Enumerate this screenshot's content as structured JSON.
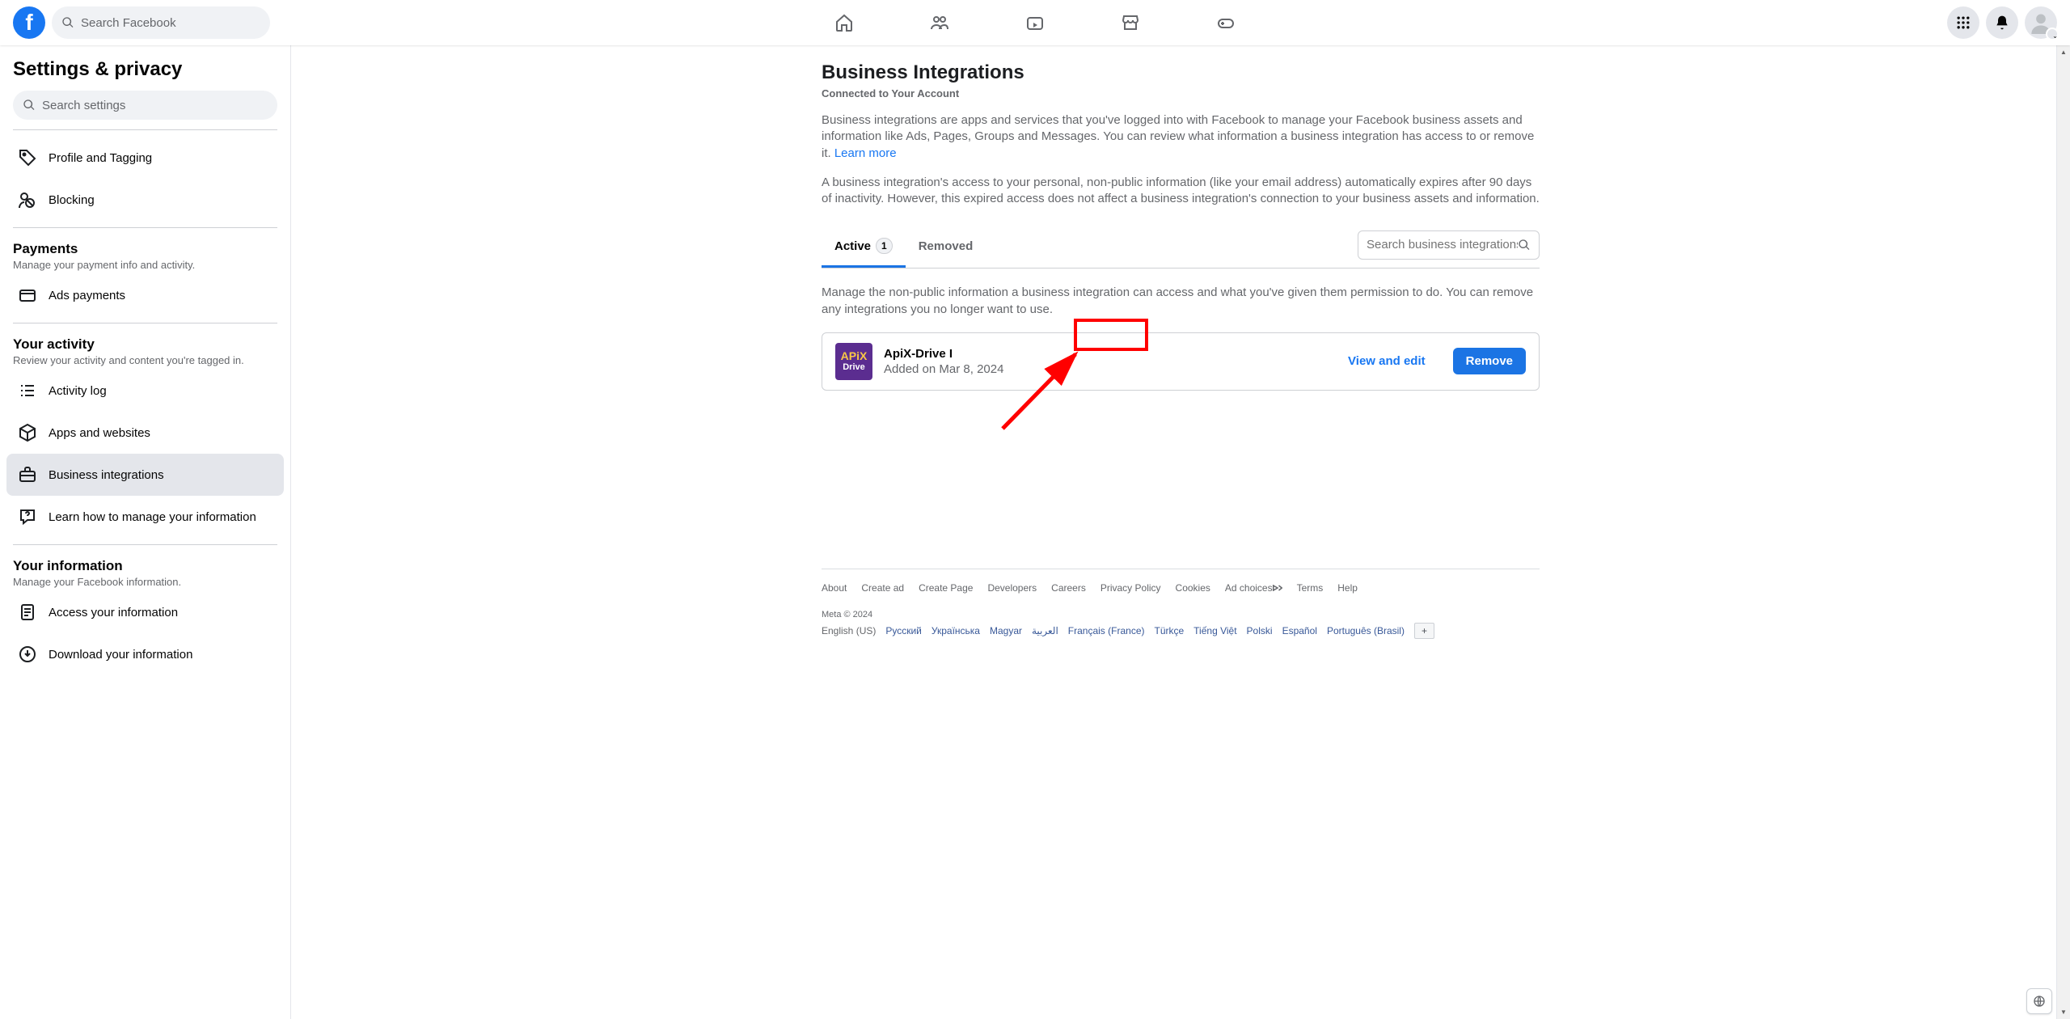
{
  "header": {
    "search_placeholder": "Search Facebook"
  },
  "sidebar": {
    "title": "Settings & privacy",
    "search_placeholder": "Search settings",
    "items_top": [
      {
        "icon": "tag",
        "label": "Profile and Tagging"
      },
      {
        "icon": "block",
        "label": "Blocking"
      }
    ],
    "sections": [
      {
        "title": "Payments",
        "sub": "Manage your payment info and activity.",
        "items": [
          {
            "icon": "card",
            "label": "Ads payments"
          }
        ]
      },
      {
        "title": "Your activity",
        "sub": "Review your activity and content you're tagged in.",
        "items": [
          {
            "icon": "list",
            "label": "Activity log"
          },
          {
            "icon": "cube",
            "label": "Apps and websites"
          },
          {
            "icon": "briefcase",
            "label": "Business integrations",
            "active": true
          },
          {
            "icon": "question",
            "label": "Learn how to manage your information"
          }
        ]
      },
      {
        "title": "Your information",
        "sub": "Manage your Facebook information.",
        "items": [
          {
            "icon": "doc",
            "label": "Access your information"
          },
          {
            "icon": "download",
            "label": "Download your information"
          }
        ]
      }
    ]
  },
  "main": {
    "title": "Business Integrations",
    "subtitle": "Connected to Your Account",
    "desc1": "Business integrations are apps and services that you've logged into with Facebook to manage your Facebook business assets and information like Ads, Pages, Groups and Messages. You can review what information a business integration has access to or remove it. ",
    "learn_more": "Learn more",
    "desc2": "A business integration's access to your personal, non-public information (like your email address) automatically expires after 90 days of inactivity. However, this expired access does not affect a business integration's connection to your business assets and information.",
    "tabs": {
      "active_label": "Active",
      "active_count": "1",
      "removed_label": "Removed",
      "search_placeholder": "Search business integrations"
    },
    "manage_text": "Manage the non-public information a business integration can access and what you've given them permission to do. You can remove any integrations you no longer want to use.",
    "integration": {
      "thumb_line1": "APiX",
      "thumb_line2": "Drive",
      "name": "ApiX-Drive I",
      "added": "Added on Mar 8, 2024",
      "view_edit": "View and edit",
      "remove": "Remove"
    }
  },
  "footer": {
    "links": [
      "About",
      "Create ad",
      "Create Page",
      "Developers",
      "Careers",
      "Privacy Policy",
      "Cookies",
      "Ad choices",
      "Terms",
      "Help"
    ],
    "meta": "Meta © 2024",
    "languages": [
      "English (US)",
      "Русский",
      "Українська",
      "Magyar",
      "العربية",
      "Français (France)",
      "Türkçe",
      "Tiếng Việt",
      "Polski",
      "Español",
      "Português (Brasil)"
    ]
  }
}
